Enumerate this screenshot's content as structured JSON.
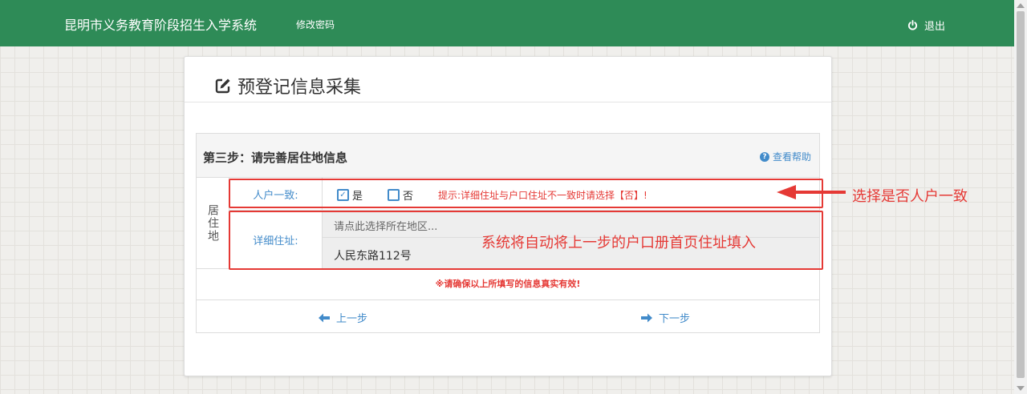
{
  "header": {
    "app_title": "昆明市义务教育阶段招生入学系统",
    "change_password": "修改密码",
    "logout": "退出",
    "bg_color": "#2e8b57"
  },
  "card": {
    "title": "预登记信息采集",
    "title_icon": "edit-icon"
  },
  "step": {
    "title": "第三步：请完善居住地信息",
    "help": "查看帮助",
    "section_label": "居住地",
    "same_household_label": "人户一致:",
    "option_yes": "是",
    "option_no": "否",
    "yes_checked": true,
    "no_checked": false,
    "hint": "提示:详细住址与户口住址不一致时请选择【否】!",
    "address_label": "详细住址:",
    "area_placeholder": "请点此选择所在地区...",
    "street_value": "人民东路112号",
    "warning": "※请确保以上所填写的信息真实有效!",
    "prev": "上一步",
    "next": "下一步"
  },
  "annotations": {
    "box1_label": "选择是否人户一致",
    "box2_label": "系统将自动将上一步的户口册首页住址填入",
    "color": "#e53935"
  }
}
